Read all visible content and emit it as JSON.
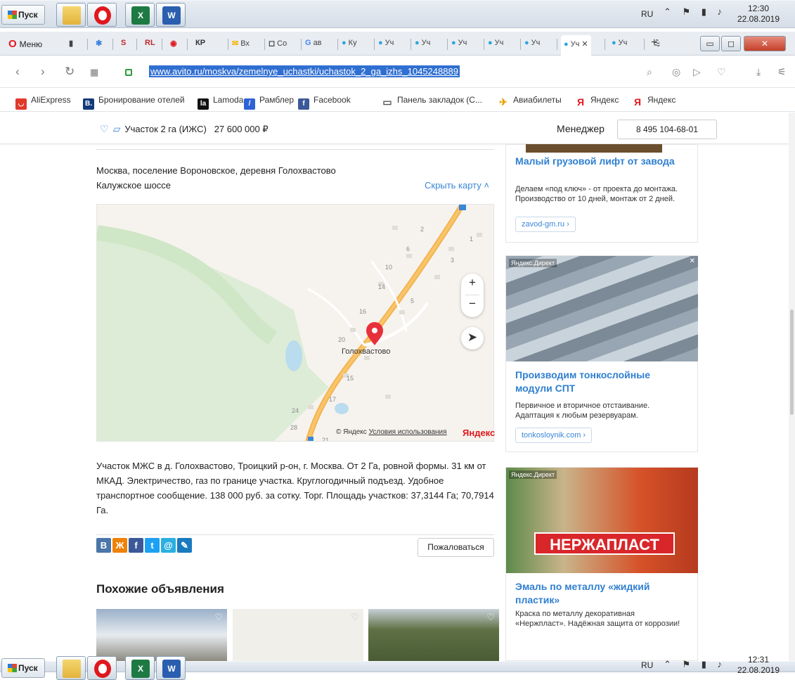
{
  "taskbar_top": {
    "start": "Пуск",
    "lang": "RU",
    "time": "12:30",
    "date": "22.08.2019"
  },
  "taskbar_bottom": {
    "start": "Пуск",
    "lang": "RU",
    "time": "12:31",
    "date": "22.08.2019"
  },
  "browser": {
    "menu": "Меню",
    "tabs": [
      {
        "icon": "КР",
        "label": ""
      },
      {
        "icon": "✉",
        "label": "Вх"
      },
      {
        "icon": "◻",
        "label": "Co"
      },
      {
        "icon": "G",
        "label": "ав"
      },
      {
        "icon": "●",
        "label": "Ку"
      },
      {
        "icon": "●",
        "label": "Уч"
      },
      {
        "icon": "●",
        "label": "Уч"
      },
      {
        "icon": "●",
        "label": "Уч"
      },
      {
        "icon": "●",
        "label": "Уч"
      },
      {
        "icon": "●",
        "label": "Уч"
      },
      {
        "icon": "●",
        "label": "Уч"
      },
      {
        "icon": "●",
        "label": "Уч"
      }
    ],
    "url": "www.avito.ru/moskva/zemelnye_uchastki/uchastok_2_ga_izhs_1045248889"
  },
  "bookmarks": [
    {
      "label": "AliExpress",
      "color": "#e0392b",
      "icon": "◡"
    },
    {
      "label": "Бронирование отелей",
      "color": "#103a7a",
      "icon": "B."
    },
    {
      "label": "Lamoda",
      "color": "#111111",
      "icon": "la"
    },
    {
      "label": "Рамблер",
      "color": "#2e63d8",
      "icon": "/"
    },
    {
      "label": "Facebook",
      "color": "#3b5998",
      "icon": "f"
    },
    {
      "label": "Панель закладок (С...",
      "color": "#ffffff",
      "icon": "▭"
    },
    {
      "label": "Авиабилеты",
      "color": "#ffffff",
      "icon": "✈"
    },
    {
      "label": "Яндекс",
      "color": "#ffffff",
      "icon": "Я"
    },
    {
      "label": "Яндекс",
      "color": "#ffffff",
      "icon": "Я"
    }
  ],
  "listing": {
    "title": "Участок 2 га (ИЖС)",
    "price": "27 600 000 ₽",
    "manager_label": "Менеджер",
    "phone": "8 495 104-68-01",
    "address1": "Москва, поселение Вороновское, деревня Голохвастово",
    "address2": "Калужское шоссе",
    "hide_map": "Скрыть карту",
    "description": "Участок МЖС в д. Голохвастово, Троицкий р-он, г. Москва. От 2 Га, ровной формы. 31 км от МКАД. Электричество, газ по границе участка. Круглогодичный подъезд. Удобное транспортное сообщение. 138 000 руб. за сотку. Торг. Площадь участков: 37,3144 Га; 70,7914 Га.",
    "complain": "Пожаловаться",
    "similar_title": "Похожие объявления"
  },
  "map": {
    "place": "Голохвастово",
    "copyright": "© Яндекс",
    "terms": "Условия использования",
    "logo": "Яндекс",
    "house_numbers": [
      "2",
      "1",
      "6",
      "3",
      "10",
      "14",
      "5",
      "16",
      "20",
      "15",
      "17",
      "24",
      "28",
      "21"
    ]
  },
  "share_buttons": [
    {
      "name": "vk",
      "icon": "В",
      "color": "#4a76a8"
    },
    {
      "name": "ok",
      "icon": "Ж",
      "color": "#ee8208"
    },
    {
      "name": "fb",
      "icon": "f",
      "color": "#3b5998"
    },
    {
      "name": "tw",
      "icon": "t",
      "color": "#1da1f2"
    },
    {
      "name": "mail",
      "icon": "@",
      "color": "#2ab0e0"
    },
    {
      "name": "lj",
      "icon": "✎",
      "color": "#1a7abf"
    }
  ],
  "ads": [
    {
      "title": "Малый грузовой лифт от завода",
      "text": "Делаем «под ключ» - от проекта до монтажа. Производство от 10 дней, монтаж от 2 дней.",
      "link": "zavod-gm.ru ›"
    },
    {
      "label": "Яндекс.Директ",
      "title": "Производим тонкослойные модули СПТ",
      "text": "Первичное и вторичное отстаивание. Адаптация к любым резервуарам.",
      "link": "tonkosloynik.com ›"
    },
    {
      "label": "Яндекс.Директ",
      "title": "Эмаль по металлу «жидкий пластик»",
      "text": "Краска по металлу декоративная «Нержпласт». Надёжная защита от коррозии!",
      "brand": "НЕРЖАПЛАСТ"
    }
  ]
}
